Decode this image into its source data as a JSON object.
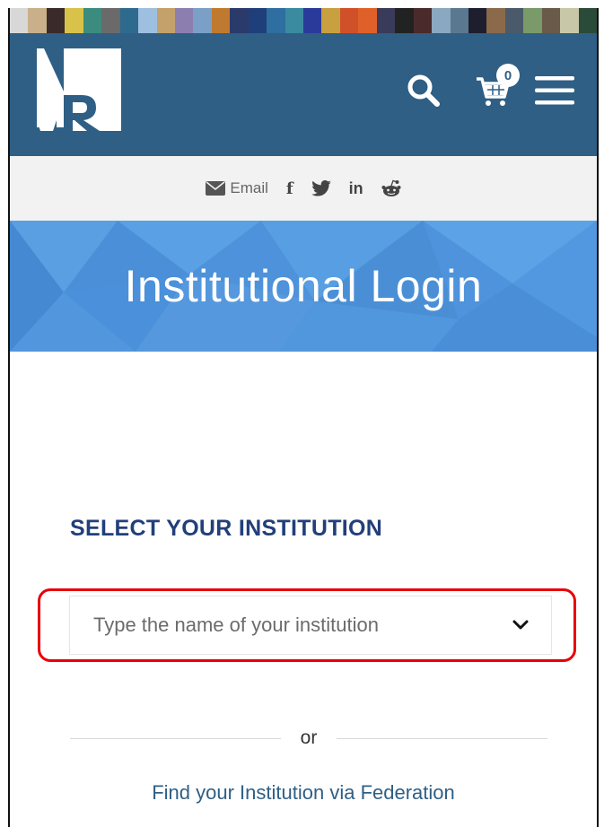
{
  "header": {
    "logo_text": "AR",
    "cart_count": "0",
    "icons": [
      "search-icon",
      "cart-icon",
      "menu-icon"
    ],
    "bg_color": "#2f5f85"
  },
  "color_strip": [
    "#d8d8d8",
    "#c9b08a",
    "#3a2a2a",
    "#d9c24a",
    "#3b8c7e",
    "#6a6a6a",
    "#2e6a8e",
    "#9fbfe0",
    "#c4a06a",
    "#8c7fb0",
    "#7aa0c8",
    "#c07a30",
    "#2a3a6a",
    "#1f3f7a",
    "#2e6ea0",
    "#3a8aa0",
    "#2a3a9a",
    "#c8a040",
    "#d0502a",
    "#e0602a",
    "#3a3a5a",
    "#222",
    "#4a2a2a",
    "#8aa8c0",
    "#5a7890",
    "#1e1e2e",
    "#8a6a4a",
    "#4a5a6a",
    "#7a9a6a",
    "#6a5a4a",
    "#c8c8a8",
    "#2a4a3a"
  ],
  "share_bar": {
    "email_label": "Email",
    "icons": [
      "email-icon",
      "facebook-icon",
      "twitter-icon",
      "linkedin-icon",
      "reddit-icon"
    ]
  },
  "banner": {
    "title": "Institutional Login"
  },
  "main": {
    "heading": "SELECT YOUR INSTITUTION",
    "select_placeholder": "Type the name of your institution",
    "or_label": "or",
    "federation_link": "Find your Institution via Federation"
  }
}
